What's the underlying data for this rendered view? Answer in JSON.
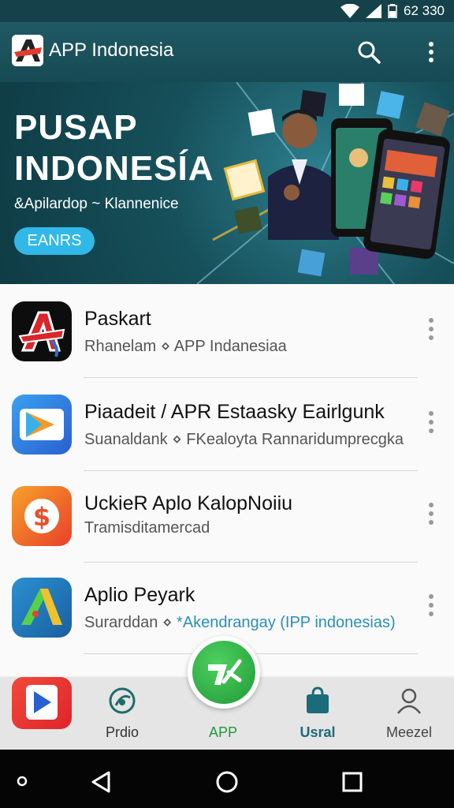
{
  "status_bar": {
    "time": "62 330"
  },
  "app_bar": {
    "title": "APP Indonesia",
    "search_icon": "search-icon",
    "more_icon": "more-vert-icon"
  },
  "banner": {
    "headline_line1": "PUSAP",
    "headline_line2": "INDONESÍA",
    "subtitle": "&Apilardop ~ Klannenice",
    "cta": "EANRS"
  },
  "apps": [
    {
      "name": "Paskart",
      "developer": "Rhanelam",
      "category": "APP Indanesiaa"
    },
    {
      "name": "Piaadeit / APR Estaasky Eairlgunk",
      "developer": "Suanaldank",
      "category": "FKealoyta Rannaridumprecgka"
    },
    {
      "name": "UckieR Aplo KalopNoiiu",
      "developer": "Tramisditamercad",
      "category": ""
    },
    {
      "name": "Aplio Peyark",
      "developer": "Surarddan",
      "category": "*Akendrangay (IPP indonesias)"
    }
  ],
  "bottom_nav": {
    "items": [
      {
        "label": "Prdio",
        "icon": "globe-icon"
      },
      {
        "label": "APP",
        "icon": "app-logo-icon"
      },
      {
        "label": "Usral",
        "icon": "bag-icon"
      },
      {
        "label": "Meezel",
        "icon": "person-icon"
      }
    ]
  },
  "colors": {
    "app_bar": "#1f5a64",
    "accent": "#31b8e8",
    "fab": "#2fb14a",
    "active_nav": "#1c8a60"
  }
}
